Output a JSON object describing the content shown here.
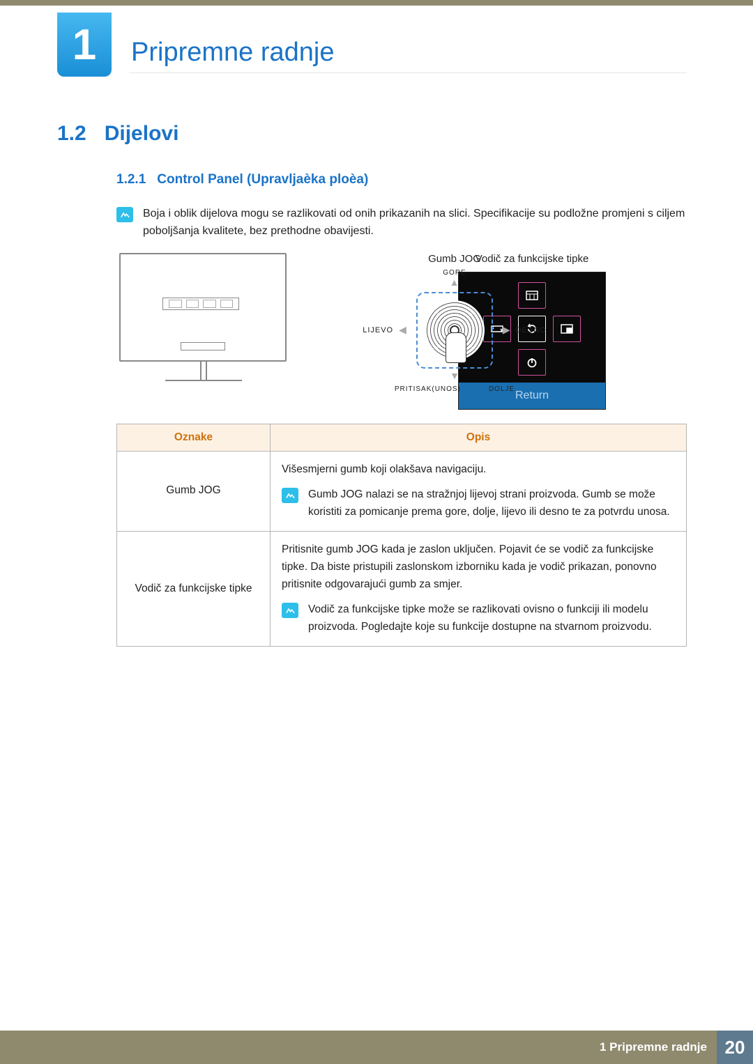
{
  "chapter": {
    "number": "1",
    "title": "Pripremne radnje"
  },
  "section": {
    "number": "1.2",
    "title": "Dijelovi"
  },
  "subsection": {
    "number": "1.2.1",
    "title": "Control Panel (Upravljaèka ploèa)"
  },
  "topNote": "Boja i oblik dijelova mogu se razlikovati od onih prikazanih na slici. Specifikacije su podložne promjeni s ciljem poboljšanja kvalitete, bez prethodne obavijesti.",
  "diagram": {
    "jogLabel": "Gumb JOG",
    "up": "GORE",
    "left": "LIJEVO",
    "right": "DESNO",
    "down": "DOLJE",
    "press": "PRITISAK(UNOS)"
  },
  "osd": {
    "title": "Vodič za funkcijske tipke",
    "returnLabel": "Return",
    "icons": {
      "menu": "menu-icon",
      "loop": "loop-icon",
      "back": "back-icon",
      "pip": "pip-icon",
      "power": "power-icon"
    }
  },
  "table": {
    "headers": {
      "col1": "Oznake",
      "col2": "Opis"
    },
    "rows": [
      {
        "label": "Gumb JOG",
        "desc": "Višesmjerni gumb koji olakšava navigaciju.",
        "note": "Gumb JOG nalazi se na stražnjoj lijevoj strani proizvoda. Gumb se može koristiti za pomicanje prema gore, dolje, lijevo ili desno te za potvrdu unosa."
      },
      {
        "label": "Vodič za funkcijske tipke",
        "desc": "Pritisnite gumb JOG kada je zaslon uključen. Pojavit će se vodič za funkcijske tipke. Da biste pristupili zaslonskom izborniku kada je vodič prikazan, ponovno pritisnite odgovarajući gumb za smjer.",
        "note": "Vodič za funkcijske tipke može se razlikovati ovisno o funkciji ili modelu proizvoda. Pogledajte koje su funkcije dostupne na stvarnom proizvodu."
      }
    ]
  },
  "footer": {
    "text": "1 Pripremne radnje",
    "page": "20"
  }
}
